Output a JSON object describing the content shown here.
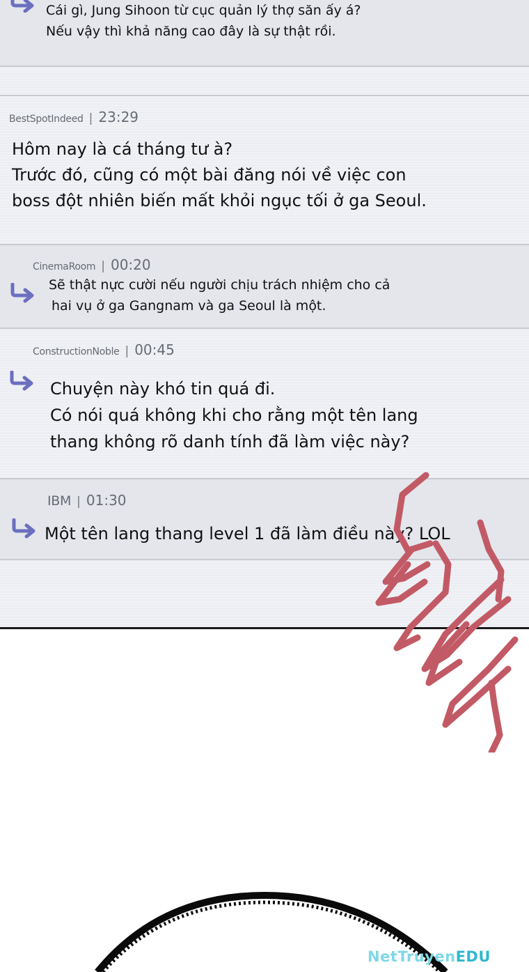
{
  "comments": [
    {
      "lines": [
        "Cái gì, Jung Sihoon từ cục quản lý thợ săn ấy á?",
        "Nếu vậy thì khả năng cao đây là sự thật rồi."
      ]
    },
    {
      "user": "BestSpotIndeed",
      "time": "23:29",
      "lines": [
        "Hôm nay là cá tháng tư à?",
        "Trước đó, cũng có một bài đăng nói về việc con",
        "boss đột nhiên biến mất khỏi ngục tối ở ga Seoul."
      ]
    },
    {
      "user": "CinemaRoom",
      "time": "00:20",
      "lines": [
        "Sẽ thật nực cười nếu người chịu trách nhiệm cho cả",
        "hai vụ ở ga Gangnam và ga Seoul là một."
      ]
    },
    {
      "user": "ConstructionNoble",
      "time": "00:45",
      "lines": [
        "Chuyện này khó tin quá đi.",
        "Có nói quá không khi cho rằng một tên lang",
        "thang không rõ danh tính đã làm việc này?"
      ]
    },
    {
      "user": "IBM",
      "time": "01:30",
      "lines": [
        "Một tên lang thang level 1 đã làm điều này? LOL"
      ]
    }
  ],
  "icons": {
    "reply": "reply-arrow-icon",
    "reply_color": "#6b6fbf"
  },
  "colors": {
    "panel_bg": "#eceef3",
    "scribble": "#c25a66",
    "watermark": "#7fd8e6"
  },
  "watermark": {
    "main": "NetTruyen",
    "edu": "EDU"
  }
}
